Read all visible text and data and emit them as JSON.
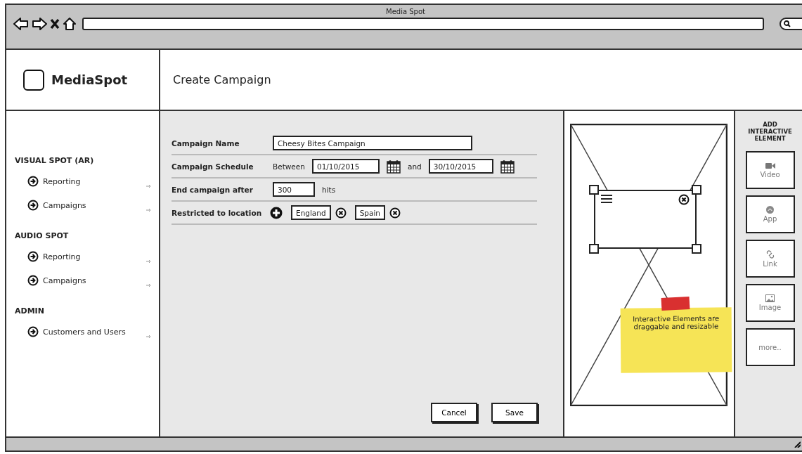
{
  "window": {
    "title": "Media Spot"
  },
  "header": {
    "logo": "MediaSpot",
    "page_title": "Create Campaign"
  },
  "sidebar": {
    "sections": [
      {
        "heading": "VISUAL SPOT (AR)",
        "items": [
          {
            "label": "Reporting"
          },
          {
            "label": "Campaigns"
          }
        ]
      },
      {
        "heading": "AUDIO SPOT",
        "items": [
          {
            "label": "Reporting"
          },
          {
            "label": "Campaigns"
          }
        ]
      },
      {
        "heading": "ADMIN",
        "items": [
          {
            "label": "Customers and Users"
          }
        ]
      }
    ]
  },
  "form": {
    "rows": [
      {
        "kind": "text",
        "label": "Campaign Name",
        "value": "Cheesy Bites Campaign"
      },
      {
        "kind": "daterange",
        "label": "Campaign Schedule",
        "prefix": "Between",
        "start": "01/10/2015",
        "joiner": "and",
        "end": "30/10/2015"
      },
      {
        "kind": "number",
        "label": "End campaign after",
        "value": "300",
        "suffix": "hits"
      },
      {
        "kind": "tags",
        "label": "Restricted to location",
        "tags": [
          "England",
          "Spain"
        ]
      }
    ],
    "buttons": [
      "Cancel",
      "Save"
    ]
  },
  "preview": {
    "note": "Interactive Elements are draggable and resizable"
  },
  "palette": {
    "title": "ADD INTERACTIVE ELEMENT",
    "items": [
      {
        "kind": "video",
        "label": "Video"
      },
      {
        "kind": "app",
        "label": "App"
      },
      {
        "kind": "link",
        "label": "Link"
      },
      {
        "kind": "image",
        "label": "Image"
      },
      {
        "kind": "more",
        "label": "more.."
      }
    ]
  }
}
